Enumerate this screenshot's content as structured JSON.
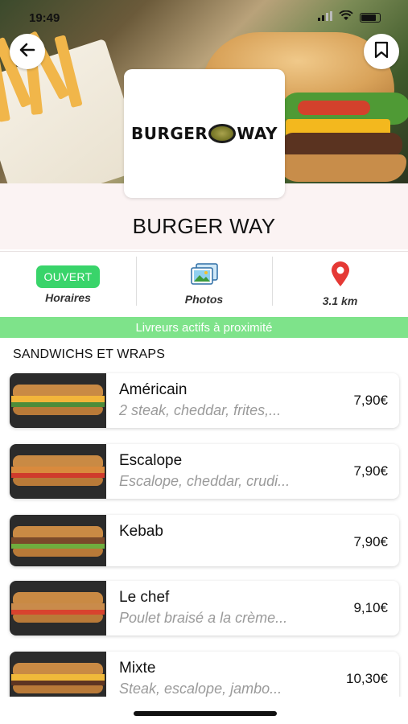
{
  "status_bar": {
    "time": "19:49"
  },
  "restaurant": {
    "name": "BURGER WAY",
    "logo_left": "BURGER",
    "logo_right": "WAY"
  },
  "tabs": [
    {
      "badge": "OUVERT",
      "label": "Horaires"
    },
    {
      "label": "Photos",
      "icon": "photos-icon"
    },
    {
      "label": "3.1 km",
      "icon": "location-pin-icon"
    }
  ],
  "delivery_banner": "Livreurs actifs à proximité",
  "section": {
    "title": "SANDWICHS ET WRAPS"
  },
  "menu_items": [
    {
      "name": "Américain",
      "desc": "2 steak, cheddar, frites,...",
      "price": "7,90€"
    },
    {
      "name": "Escalope",
      "desc": "Escalope, cheddar, crudi...",
      "price": "7,90€"
    },
    {
      "name": "Kebab",
      "desc": "",
      "price": "7,90€"
    },
    {
      "name": "Le chef",
      "desc": "Poulet braisé a la crème...",
      "price": "9,10€"
    },
    {
      "name": "Mixte",
      "desc": "Steak, escalope, jambo...",
      "price": "10,30€"
    }
  ],
  "colors": {
    "open_badge": "#39d46a",
    "delivery_banner": "#7ee38a",
    "location_pin": "#e53935"
  }
}
